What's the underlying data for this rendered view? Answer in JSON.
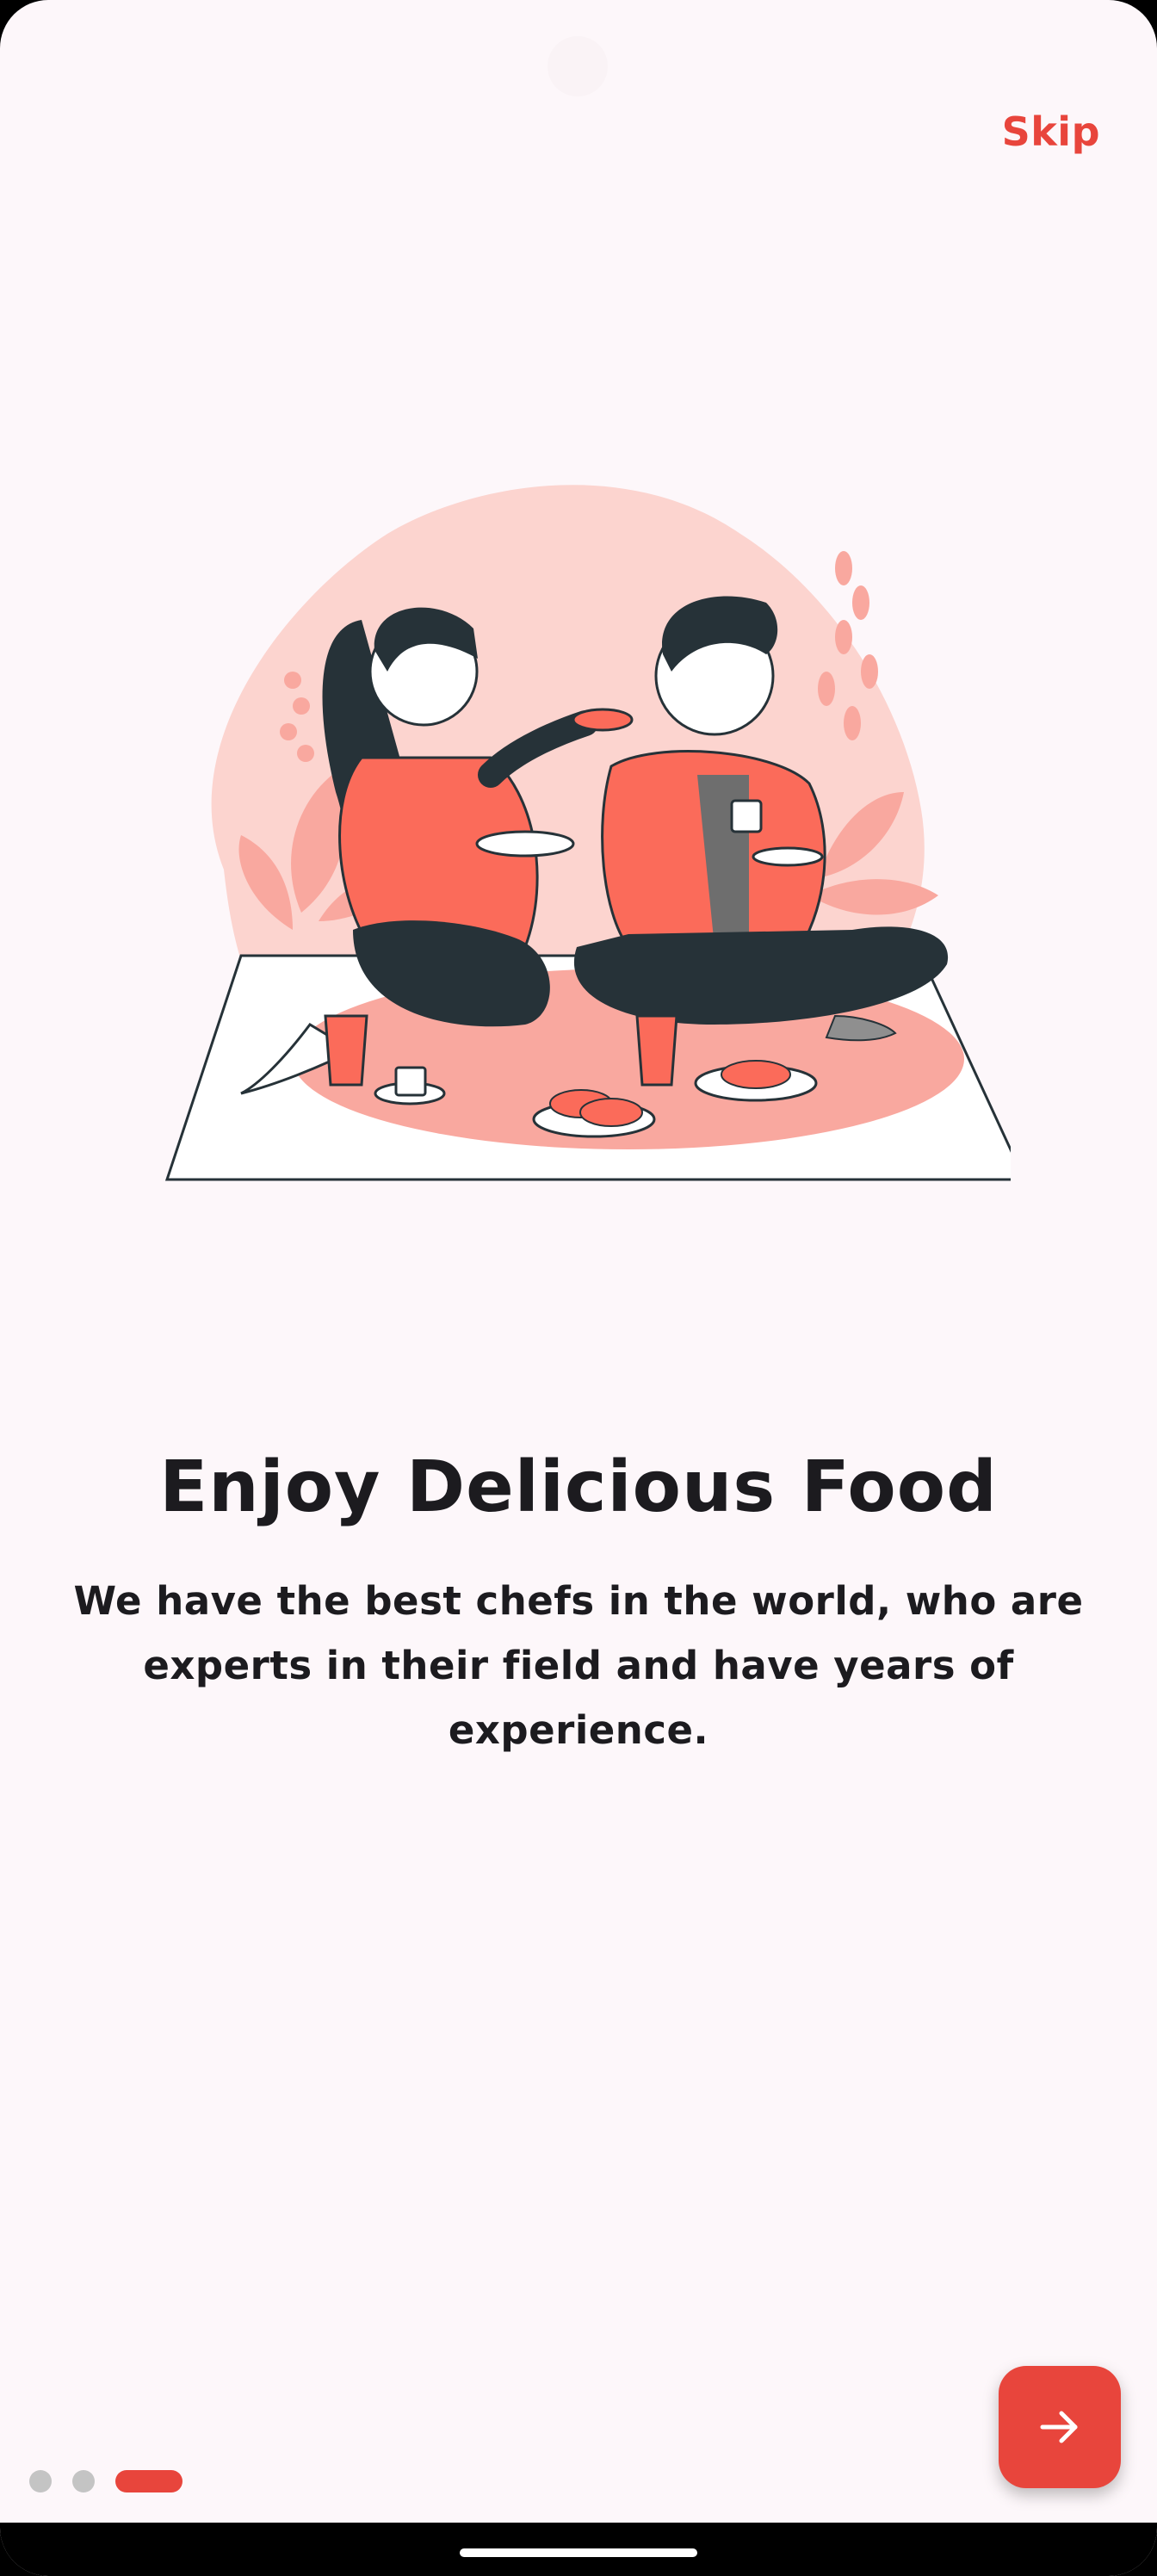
{
  "header": {
    "skip_label": "Skip"
  },
  "onboarding": {
    "title": "Enjoy Delicious Food",
    "description": "We have the best chefs in the world, who are experts in their field and have years of experience.",
    "page_count": 3,
    "current_page": 3
  },
  "next_button": {
    "icon": "arrow-right-icon"
  },
  "colors": {
    "accent": "#e8453c",
    "background": "#fdf7fa",
    "text": "#1c1b1f",
    "inactive_dot": "#c4c4c4"
  }
}
